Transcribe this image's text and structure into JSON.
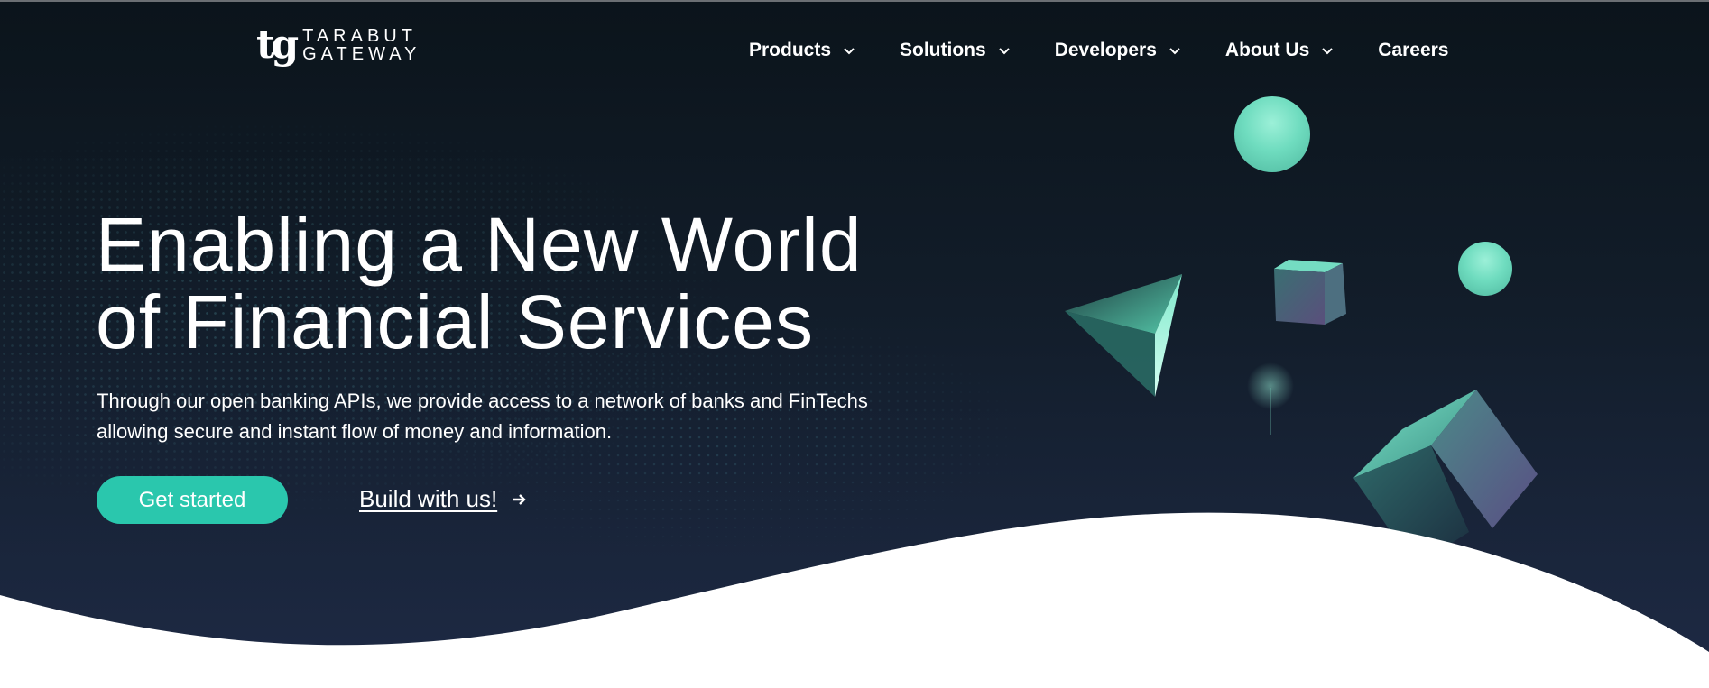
{
  "brand": {
    "logo_mark": "tg",
    "logo_line1": "TARABUT",
    "logo_line2": "GATEWAY"
  },
  "nav": {
    "items": [
      {
        "label": "Products",
        "has_dropdown": true
      },
      {
        "label": "Solutions",
        "has_dropdown": true
      },
      {
        "label": "Developers",
        "has_dropdown": true
      },
      {
        "label": "About Us",
        "has_dropdown": true
      },
      {
        "label": "Careers",
        "has_dropdown": false
      }
    ]
  },
  "hero": {
    "headline_line1": "Enabling a New World",
    "headline_line2": "of Financial Services",
    "subtext_line1": "Through our open banking APIs, we provide access to a network of banks and FinTechs",
    "subtext_line2": "allowing secure and instant flow of money and information.",
    "primary_cta": "Get started",
    "secondary_cta": "Build with us!"
  },
  "colors": {
    "accent": "#2ac7ad",
    "background_dark": "#0b141b",
    "background_bottom": "#1e2a45",
    "text": "#ffffff"
  },
  "icons": {
    "dropdown": "chevron-down-icon",
    "cta_arrow": "arrow-right-icon"
  }
}
